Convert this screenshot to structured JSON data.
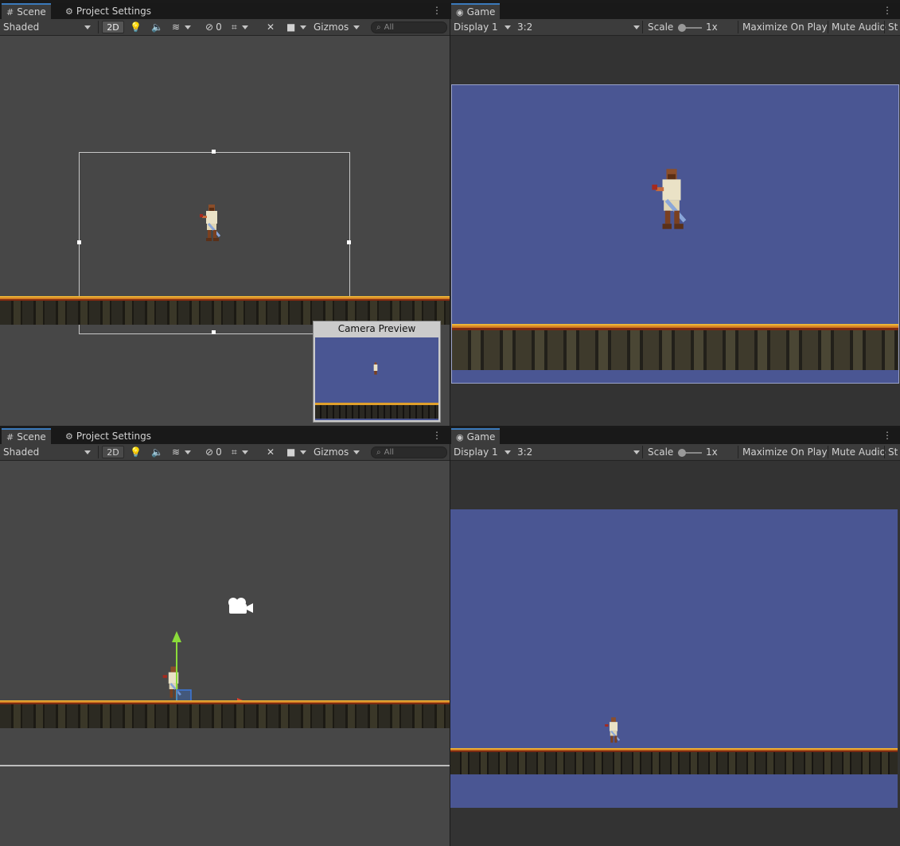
{
  "panels": {
    "scene_top": {
      "tabs": [
        {
          "label": "Scene",
          "icon": "grid-icon"
        },
        {
          "label": "Project Settings",
          "icon": "gear-icon"
        }
      ],
      "toolbar": {
        "shading": "Shaded",
        "mode_2d": "2D",
        "hidden_count": "0",
        "gizmos": "Gizmos",
        "search_placeholder": "All"
      },
      "camera_preview_title": "Camera Preview"
    },
    "game_top": {
      "tabs": [
        {
          "label": "Game",
          "icon": "gamepad-icon"
        }
      ],
      "toolbar": {
        "display": "Display 1",
        "aspect": "3:2",
        "scale_label": "Scale",
        "scale_value": "1x",
        "maximize": "Maximize On Play",
        "mute": "Mute Audio",
        "stats": "St"
      }
    },
    "scene_bottom": {
      "tabs": [
        {
          "label": "Scene",
          "icon": "grid-icon"
        },
        {
          "label": "Project Settings",
          "icon": "gear-icon"
        }
      ],
      "toolbar": {
        "shading": "Shaded",
        "mode_2d": "2D",
        "hidden_count": "0",
        "gizmos": "Gizmos",
        "search_placeholder": "All"
      }
    },
    "game_bottom": {
      "tabs": [
        {
          "label": "Game",
          "icon": "gamepad-icon"
        }
      ],
      "toolbar": {
        "display": "Display 1",
        "aspect": "3:2",
        "scale_label": "Scale",
        "scale_value": "1x",
        "maximize": "Maximize On Play",
        "mute": "Mute Audio",
        "stats": "St"
      }
    }
  },
  "colors": {
    "scene_bg": "#474747",
    "game_sky": "#4a5693",
    "letterbox": "#333333",
    "tab_accent": "#3a79bb"
  }
}
